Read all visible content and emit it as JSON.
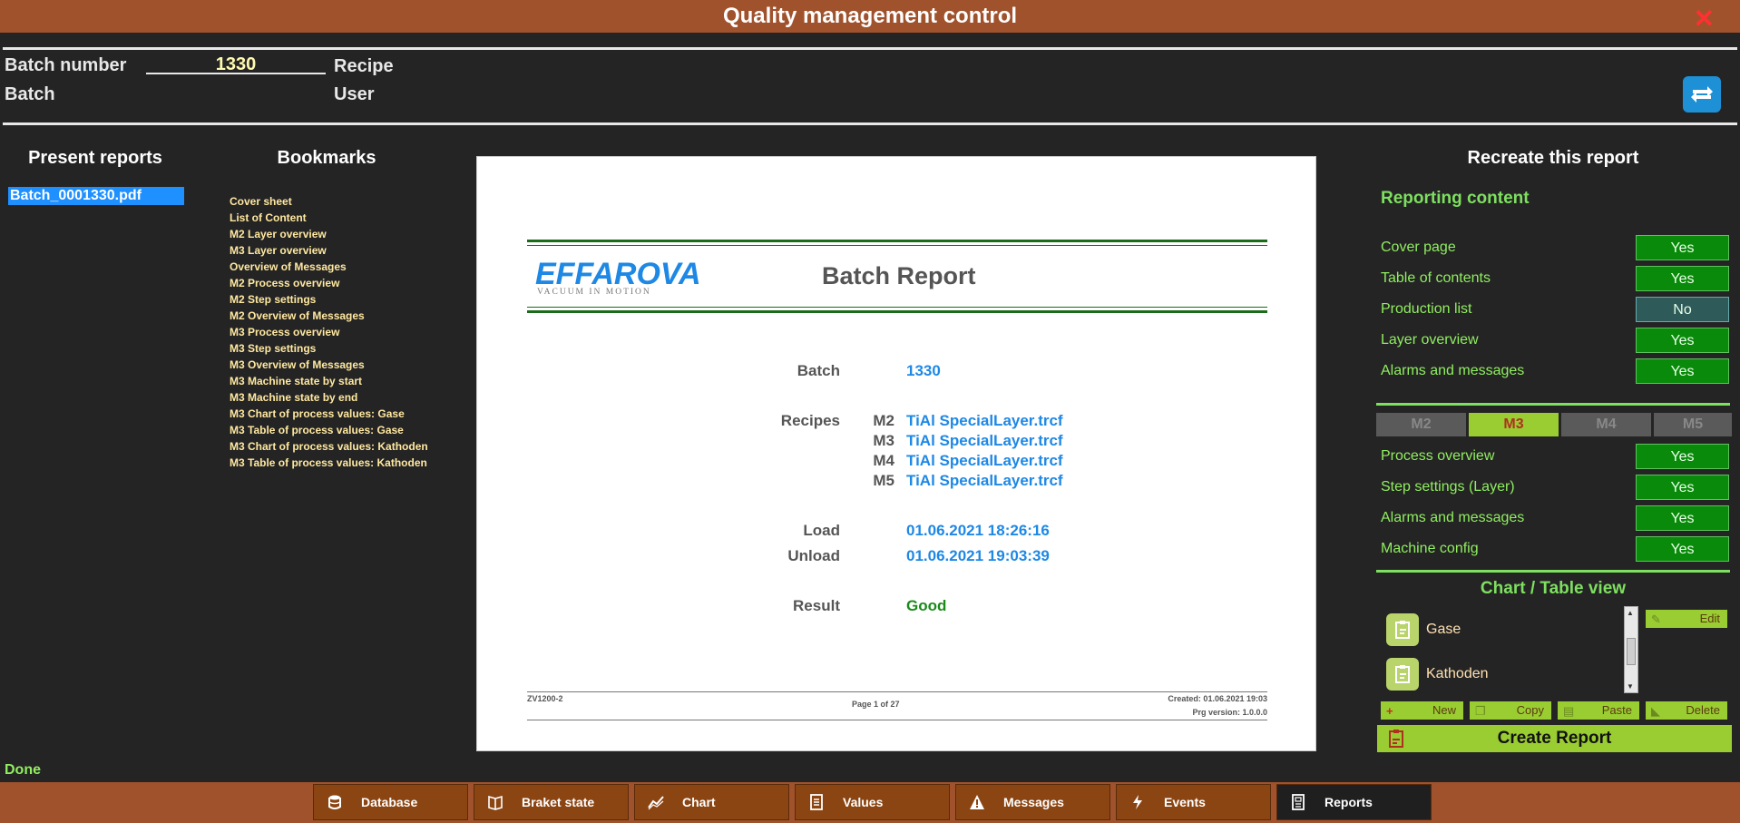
{
  "window": {
    "title": "Quality management control"
  },
  "header": {
    "batch_number_label": "Batch number",
    "batch_number_value": "1330",
    "recipe_label": "Recipe",
    "batch_label": "Batch",
    "user_label": "User"
  },
  "present_reports": {
    "title": "Present reports",
    "files": [
      "Batch_0001330.pdf"
    ]
  },
  "bookmarks": {
    "title": "Bookmarks",
    "items": [
      "Cover sheet",
      "List of Content",
      "M2 Layer overview",
      "M3 Layer overview",
      "Overview of Messages",
      "M2 Process overview",
      "M2 Step settings",
      "M2 Overview of Messages",
      "M3 Process overview",
      "M3 Step settings",
      "M3 Overview of Messages",
      "M3 Machine state by start",
      "M3 Machine state by end",
      "M3 Chart of process values: Gase",
      "M3 Table of process values: Gase",
      "M3 Chart of process values: Kathoden",
      "M3 Table of process values: Kathoden"
    ]
  },
  "preview": {
    "logo_text": "EFFAROVAC",
    "logo_sub": "VACUUM IN MOTION",
    "title": "Batch Report",
    "batch_label": "Batch",
    "batch_value": "1330",
    "recipes_label": "Recipes",
    "recipes": [
      {
        "machine": "M2",
        "file": "TiAl SpecialLayer.trcf"
      },
      {
        "machine": "M3",
        "file": "TiAl SpecialLayer.trcf"
      },
      {
        "machine": "M4",
        "file": "TiAl SpecialLayer.trcf"
      },
      {
        "machine": "M5",
        "file": "TiAl SpecialLayer.trcf"
      }
    ],
    "load_label": "Load",
    "load_value": "01.06.2021 18:26:16",
    "unload_label": "Unload",
    "unload_value": "01.06.2021 19:03:39",
    "result_label": "Result",
    "result_value": "Good",
    "footer_left": "ZV1200-2",
    "footer_center": "Page 1 of 27",
    "footer_created": "Created: 01.06.2021 19:03",
    "footer_version": "Prg version: 1.0.0.0"
  },
  "recreate": {
    "title": "Recreate this report",
    "content_title": "Reporting content",
    "general_options": [
      {
        "label": "Cover page",
        "value": "Yes"
      },
      {
        "label": "Table of contents",
        "value": "Yes"
      },
      {
        "label": "Production list",
        "value": "No"
      },
      {
        "label": "Layer overview",
        "value": "Yes"
      },
      {
        "label": "Alarms and messages",
        "value": "Yes"
      }
    ],
    "machine_tabs": [
      "M2",
      "M3",
      "M4",
      "M5"
    ],
    "active_tab": "M3",
    "machine_options": [
      {
        "label": "Process overview",
        "value": "Yes"
      },
      {
        "label": "Step settings (Layer)",
        "value": "Yes"
      },
      {
        "label": "Alarms and messages",
        "value": "Yes"
      },
      {
        "label": "Machine config",
        "value": "Yes"
      }
    ],
    "chart_table_title": "Chart / Table view",
    "chart_items": [
      "Gase",
      "Kathoden"
    ],
    "edit_label": "Edit",
    "new_label": "New",
    "copy_label": "Copy",
    "paste_label": "Paste",
    "delete_label": "Delete",
    "create_label": "Create Report"
  },
  "status": "Done",
  "nav": [
    {
      "label": "Database",
      "icon": "database-icon"
    },
    {
      "label": "Braket state",
      "icon": "book-icon"
    },
    {
      "label": "Chart",
      "icon": "chart-line-icon"
    },
    {
      "label": "Values",
      "icon": "document-icon"
    },
    {
      "label": "Messages",
      "icon": "warning-icon"
    },
    {
      "label": "Events",
      "icon": "lightning-icon"
    },
    {
      "label": "Reports",
      "icon": "report-icon"
    }
  ],
  "nav_active": "Reports",
  "colors": {
    "title_bar": "#a0522d",
    "accent_green": "#9acd32",
    "yes_green": "#0a8a0a",
    "link_blue": "#1e88e5"
  }
}
